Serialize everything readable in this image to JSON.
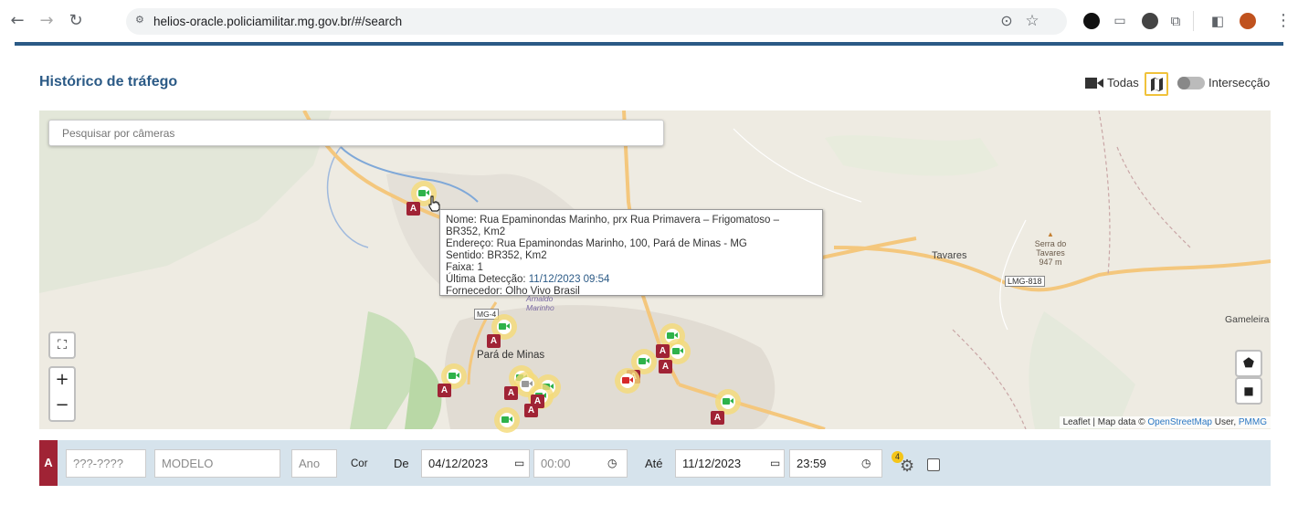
{
  "browser": {
    "url": "helios-oracle.policiamilitar.mg.gov.br/#/search"
  },
  "page": {
    "title": "Histórico de tráfego",
    "todas_label": "Todas",
    "interseccao_label": "Intersecção"
  },
  "map": {
    "search_placeholder": "Pesquisar por câmeras",
    "tooltip": {
      "nome": "Nome: Rua Epaminondas Marinho, prx Rua Primavera – Frigomatoso – BR352, Km2",
      "endereco": "Endereço: Rua Epaminondas Marinho, 100, Pará de Minas - MG",
      "sentido": "Sentido: BR352, Km2",
      "faixa": "Faixa: 1",
      "ultima_label": "Última Detecção:",
      "ultima_value": "11/12/2023 09:54",
      "fornecedor": "Fornecedor: Olho Vivo Brasil"
    },
    "labels": {
      "tavares": "Tavares",
      "serra_line1": "Serra do",
      "serra_line2": "Tavares",
      "serra_line3": "947 m",
      "lmg": "LMG-818",
      "gameleira": "Gameleira",
      "para_de_minas": "Pará de Minas",
      "arnaldo": "Arnaldo",
      "marinho": "Marinho",
      "mg": "MG-4"
    },
    "badge_letter": "A",
    "attribution_prefix": "Leaflet | Map data ©",
    "attribution_osm": "OpenStreetMap",
    "attribution_user": "User,",
    "attribution_pmmg": "PMMG"
  },
  "filters": {
    "plate_badge": "A",
    "plate_placeholder": "???-????",
    "modelo_placeholder": "MODELO",
    "ano_placeholder": "Ano",
    "cor_label": "Cor",
    "de_label": "De",
    "date_from": "04/12/2023",
    "time_from": "00:00",
    "ate_label": "Até",
    "date_to": "11/12/2023",
    "time_to": "23:59",
    "settings_count": "4"
  }
}
